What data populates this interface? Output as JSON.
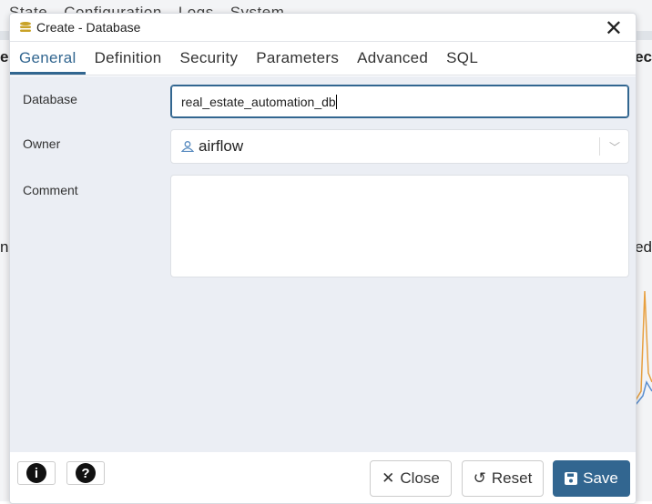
{
  "background": {
    "nav": [
      "State",
      "Configuration",
      "Logs",
      "System"
    ],
    "fragments": [
      "e",
      "ec",
      "n",
      "ed"
    ]
  },
  "dialog": {
    "title": "Create - Database",
    "tabs": [
      {
        "label": "General",
        "active": true
      },
      {
        "label": "Definition"
      },
      {
        "label": "Security"
      },
      {
        "label": "Parameters"
      },
      {
        "label": "Advanced"
      },
      {
        "label": "SQL"
      }
    ],
    "fields": {
      "database": {
        "label": "Database",
        "value": "real_estate_automation_db"
      },
      "owner": {
        "label": "Owner",
        "value": "airflow"
      },
      "comment": {
        "label": "Comment",
        "value": ""
      }
    },
    "footer": {
      "close": "Close",
      "reset": "Reset",
      "save": "Save"
    }
  },
  "colors": {
    "accent": "#326690"
  }
}
